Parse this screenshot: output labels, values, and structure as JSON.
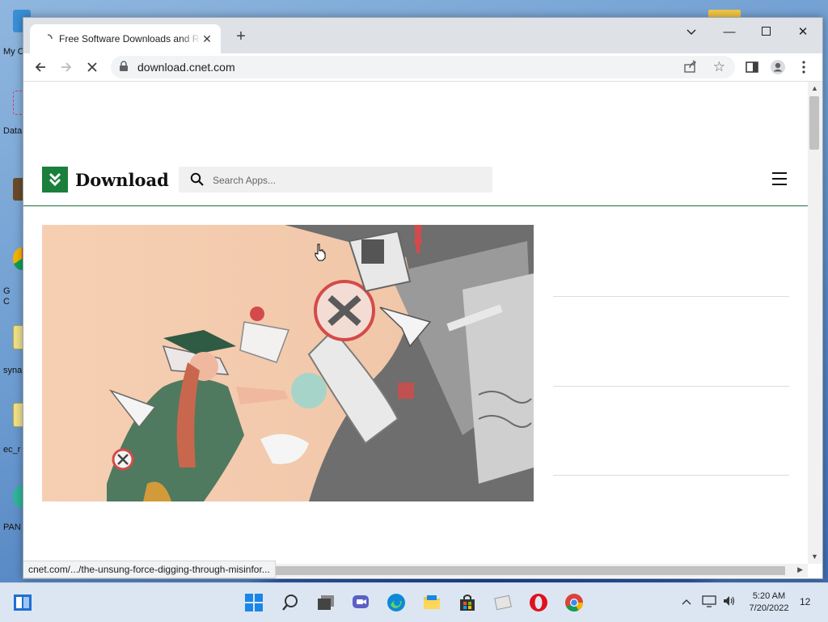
{
  "desktop": {
    "icons": [
      {
        "label": "My C",
        "name": "desktop-icon-my-computer"
      },
      {
        "label": "Data",
        "name": "desktop-icon-data"
      },
      {
        "label": "",
        "name": "desktop-icon-photo"
      },
      {
        "label": "G\nC",
        "name": "desktop-icon-chrome"
      },
      {
        "label": "syna",
        "name": "desktop-icon-syna"
      },
      {
        "label": "ec_r",
        "name": "desktop-icon-ec"
      },
      {
        "label": "PAN",
        "name": "desktop-icon-pan"
      }
    ]
  },
  "browser": {
    "tab": {
      "title": "Free Software Downloads and Reviews"
    },
    "address": {
      "url": "download.cnet.com"
    },
    "status_bar": "cnet.com/.../the-unsung-force-digging-through-misinfor..."
  },
  "site": {
    "logo_text": "Download",
    "search": {
      "placeholder": "Search Apps..."
    }
  },
  "taskbar": {
    "clock": {
      "time": "5:20 AM",
      "date": "7/20/2022"
    },
    "notification_count": "12"
  },
  "colors": {
    "brand_green": "#1a7f3c",
    "taskbar_bg": "#dce6f2",
    "tab_bar": "#dee1e6"
  }
}
